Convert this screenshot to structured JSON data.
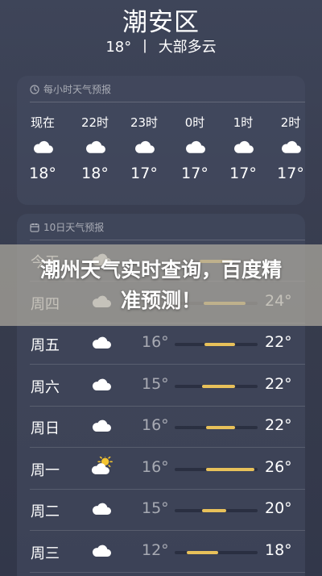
{
  "location": "潮安区",
  "current": {
    "temp": "18°",
    "separator": "丨",
    "condition": "大部多云"
  },
  "hourly": {
    "header": "每小时天气预报",
    "header_icon": "clock-icon",
    "items": [
      {
        "time": "现在",
        "icon": "cloud-icon",
        "temp": "18°"
      },
      {
        "time": "22时",
        "icon": "cloud-icon",
        "temp": "18°"
      },
      {
        "time": "23时",
        "icon": "cloud-icon",
        "temp": "17°"
      },
      {
        "time": "0时",
        "icon": "cloud-icon",
        "temp": "17°"
      },
      {
        "time": "1时",
        "icon": "cloud-icon",
        "temp": "17°"
      },
      {
        "time": "2时",
        "icon": "cloud-icon",
        "temp": "17°"
      }
    ]
  },
  "daily": {
    "header": "10日天气预报",
    "header_icon": "calendar-icon",
    "range_color": "#e8c15a",
    "days": [
      {
        "day": "今天",
        "icon": "cloud-icon",
        "low": "",
        "high": "",
        "low_frac": 0.3,
        "high_frac": 0.7
      },
      {
        "day": "周四",
        "icon": "cloud-icon",
        "low": "",
        "high": "24°",
        "low_frac": 0.35,
        "high_frac": 0.85
      },
      {
        "day": "周五",
        "icon": "cloud-icon",
        "low": "16°",
        "high": "22°",
        "low_frac": 0.36,
        "high_frac": 0.73
      },
      {
        "day": "周六",
        "icon": "cloud-icon",
        "low": "15°",
        "high": "22°",
        "low_frac": 0.33,
        "high_frac": 0.73
      },
      {
        "day": "周日",
        "icon": "cloud-icon",
        "low": "16°",
        "high": "22°",
        "low_frac": 0.38,
        "high_frac": 0.73
      },
      {
        "day": "周一",
        "icon": "sun-cloud-icon",
        "low": "16°",
        "high": "26°",
        "low_frac": 0.38,
        "high_frac": 0.96
      },
      {
        "day": "周二",
        "icon": "cloud-icon",
        "low": "15°",
        "high": "20°",
        "low_frac": 0.33,
        "high_frac": 0.62
      },
      {
        "day": "周三",
        "icon": "cloud-icon",
        "low": "12°",
        "high": "18°",
        "low_frac": 0.15,
        "high_frac": 0.52
      }
    ]
  },
  "banner": {
    "text": "潮州天气实时查询，百度精准预测！"
  }
}
